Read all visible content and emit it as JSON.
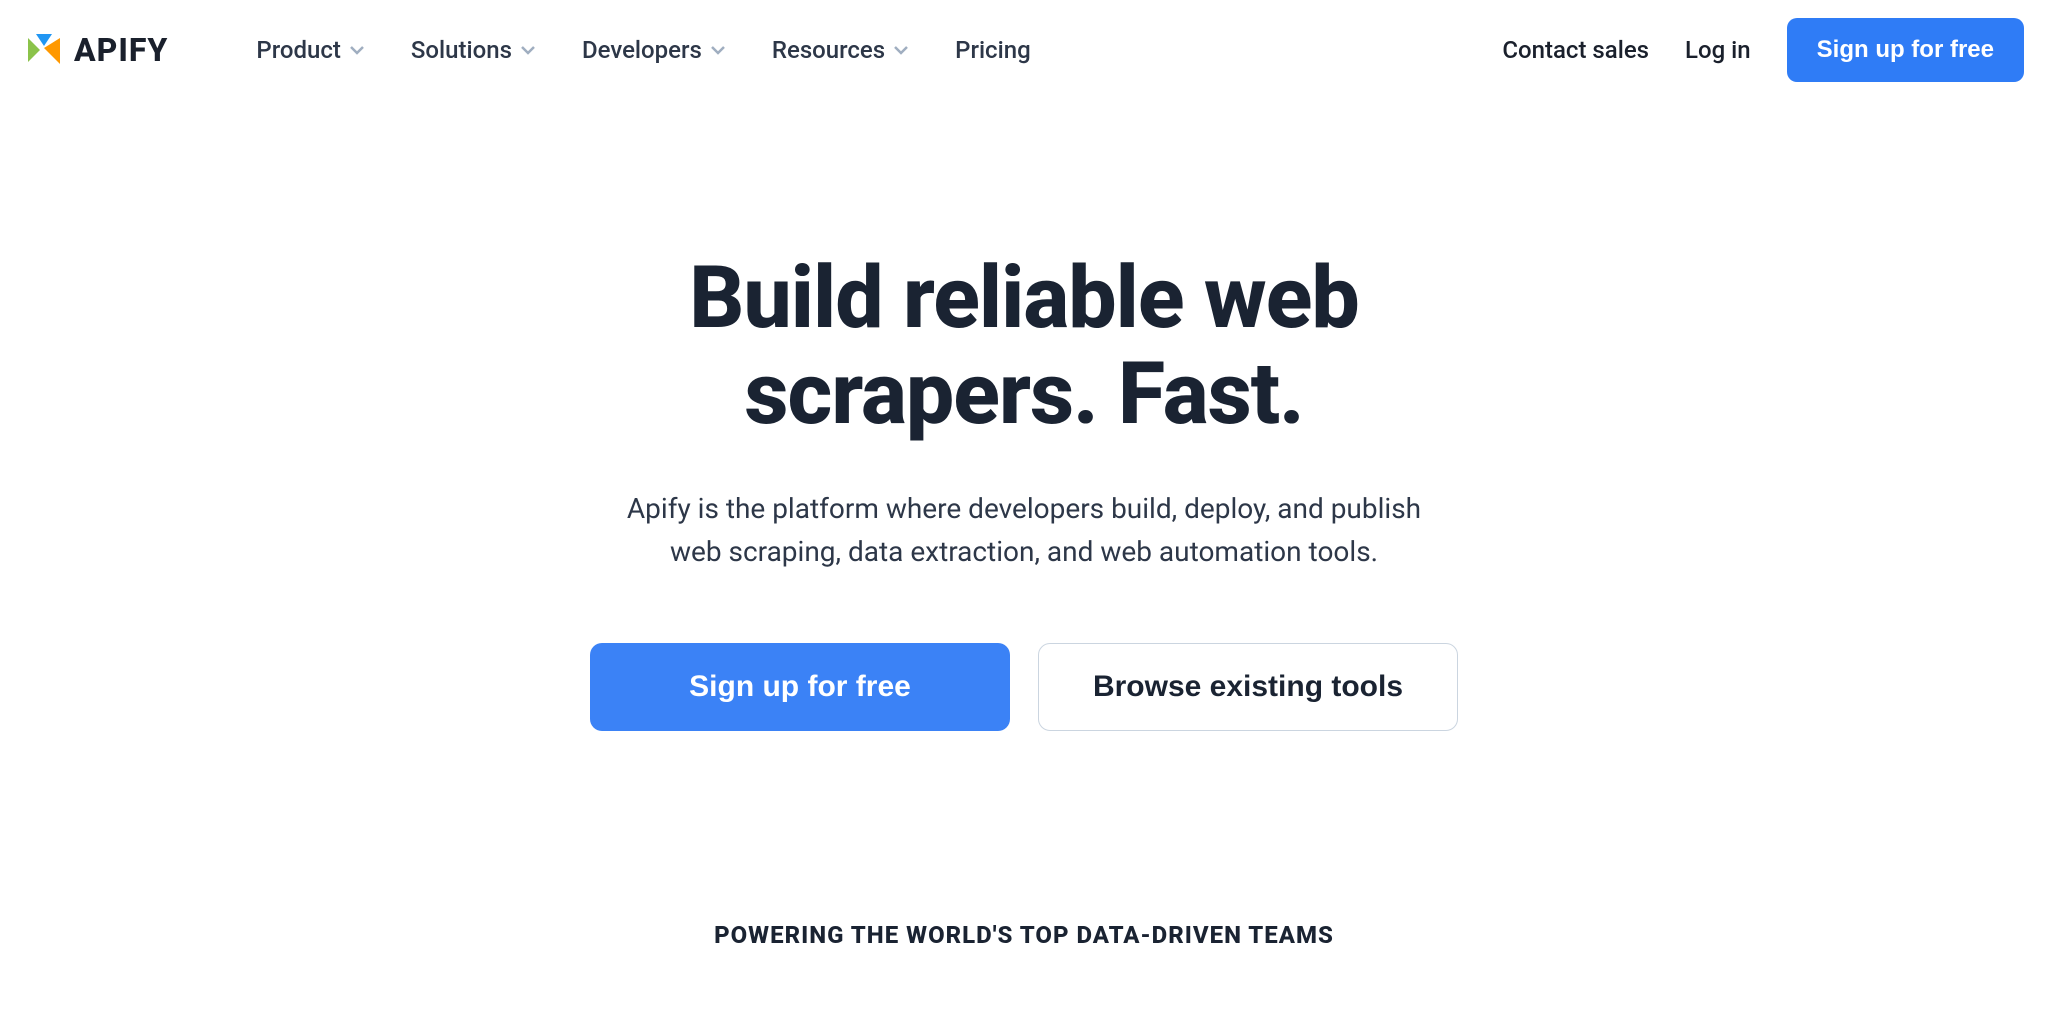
{
  "brand": "APIFY",
  "nav": {
    "items": [
      {
        "label": "Product",
        "hasDropdown": true
      },
      {
        "label": "Solutions",
        "hasDropdown": true
      },
      {
        "label": "Developers",
        "hasDropdown": true
      },
      {
        "label": "Resources",
        "hasDropdown": true
      },
      {
        "label": "Pricing",
        "hasDropdown": false
      }
    ],
    "contact": "Contact sales",
    "login": "Log in",
    "signup": "Sign up for free"
  },
  "hero": {
    "headline_l1": "Build reliable web",
    "headline_l2": "scrapers. Fast.",
    "sub_l1": "Apify is the platform where developers build, deploy, and publish",
    "sub_l2": "web scraping, data extraction, and web automation tools.",
    "cta_primary": "Sign up for free",
    "cta_secondary": "Browse existing tools"
  },
  "footer_tagline": "POWERING THE WORLD'S TOP DATA-DRIVEN TEAMS"
}
